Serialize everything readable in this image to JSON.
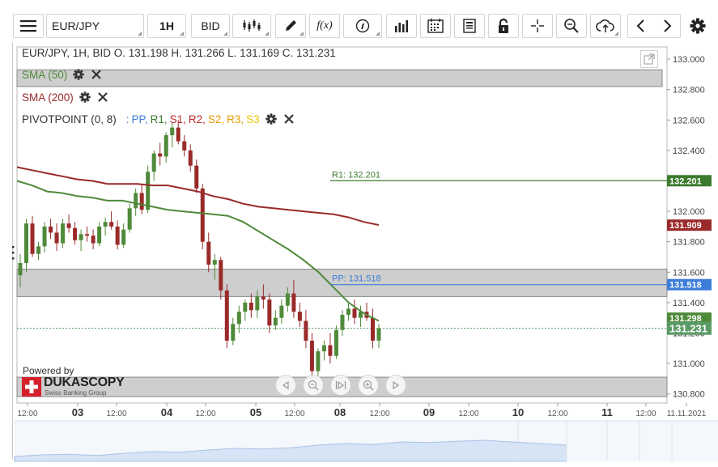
{
  "toolbar": {
    "instrument": "EUR/JPY",
    "timeframe": "1H",
    "offer_side": "BID",
    "function_label": "f(x)",
    "icons": [
      "menu-icon",
      "candle-type-icon",
      "pencil-icon",
      "function-icon",
      "info-icon",
      "bar-chart-icon",
      "calendar-icon",
      "report-icon",
      "lock-icon",
      "crosshair-icon",
      "zoom-icon",
      "cloud-upload-icon",
      "chevron-left-icon",
      "chevron-right-icon",
      "gear-icon"
    ]
  },
  "legend": {
    "ohlc": "EUR/JPY, 1H, BID    O. 131.198 H. 131.266 L. 131.169 C. 131.231",
    "sma50": "SMA (50)",
    "sma200": "SMA (200)",
    "pivot": "PIVOTPOINT (0, 8)",
    "pivot_sep": ":",
    "pivot_levels": [
      "PP,",
      "R1,",
      "S1,",
      "R2,",
      "S2,",
      "R3,",
      "S3"
    ],
    "pivot_colors": [
      "#3b7dd8",
      "#3c7a2e",
      "#c02a2a",
      "#c02a2a",
      "#e69a00",
      "#e69a00",
      "#e6c600"
    ]
  },
  "branding": {
    "powered_by": "Powered by",
    "logo_text": "DUKASCOPY",
    "logo_sub": "Swiss Banking Group"
  },
  "colors": {
    "sma50": "#4f8a3a",
    "sma200": "#9a2a2a",
    "candle_up": "#4f8a3a",
    "candle_down": "#9a2a2a",
    "pp_line": "#3b7dd8",
    "r1_line": "#3c7a2e",
    "price_label": "#5a9a66",
    "zone": "#c6c6c6"
  },
  "chart_data": {
    "type": "candlestick",
    "ylim": [
      130.74,
      133.08
    ],
    "y_ticks": [
      "133.000",
      "132.800",
      "132.600",
      "132.400",
      "132.200",
      "132.000",
      "131.800",
      "131.600",
      "131.400",
      "131.200",
      "131.000",
      "130.800"
    ],
    "x_ticks": [
      "12:00",
      "03",
      "12:00",
      "04",
      "12:00",
      "05",
      "12:00",
      "08",
      "12:00",
      "09",
      "12:00",
      "10",
      "12:00",
      "11",
      "12:00",
      "11.11.2021"
    ],
    "price_labels": [
      {
        "label": "132.201",
        "value": 132.201,
        "kind": "r1"
      },
      {
        "label": "131.909",
        "value": 131.909,
        "kind": "sma200"
      },
      {
        "label": "131.518",
        "value": 131.518,
        "kind": "pp"
      },
      {
        "label": "131.298",
        "value": 131.298,
        "kind": "sma50"
      },
      {
        "label": "131.231",
        "value": 131.231,
        "kind": "last"
      }
    ],
    "pivot_lines": [
      {
        "label": "R1: 132.201",
        "value": 132.201
      },
      {
        "label": "PP: 131.518",
        "value": 131.518
      }
    ],
    "zones": [
      {
        "from": 132.82,
        "to": 132.93
      },
      {
        "from": 131.44,
        "to": 131.62
      },
      {
        "from": 130.88,
        "to": 130.91
      }
    ],
    "series": [
      {
        "name": "SMA (50)",
        "values": [
          132.2,
          132.17,
          132.13,
          132.12,
          132.1,
          132.09,
          132.07,
          132.07,
          132.05,
          132.03,
          132.01,
          132,
          131.99,
          131.98,
          131.97,
          131.93,
          131.87,
          131.81,
          131.75,
          131.68,
          131.6,
          131.5,
          131.4,
          131.33,
          131.28
        ]
      },
      {
        "name": "SMA (200)",
        "values": [
          132.29,
          132.27,
          132.25,
          132.23,
          132.21,
          132.2,
          132.18,
          132.18,
          132.18,
          132.17,
          132.17,
          132.15,
          132.13,
          132.1,
          132.08,
          132.05,
          132.03,
          132.02,
          132.01,
          132,
          131.99,
          131.98,
          131.96,
          131.93,
          131.91
        ]
      }
    ],
    "candles_ohlc": [
      [
        131.58,
        131.72,
        131.5,
        131.66
      ],
      [
        131.66,
        131.95,
        131.6,
        131.92
      ],
      [
        131.92,
        131.97,
        131.7,
        131.72
      ],
      [
        131.72,
        131.8,
        131.68,
        131.77
      ],
      [
        131.77,
        131.93,
        131.73,
        131.9
      ],
      [
        131.9,
        131.95,
        131.82,
        131.86
      ],
      [
        131.86,
        131.92,
        131.74,
        131.79
      ],
      [
        131.79,
        131.95,
        131.76,
        131.92
      ],
      [
        131.92,
        131.98,
        131.86,
        131.89
      ],
      [
        131.89,
        131.93,
        131.78,
        131.81
      ],
      [
        131.81,
        131.88,
        131.74,
        131.85
      ],
      [
        131.85,
        131.9,
        131.8,
        131.84
      ],
      [
        131.84,
        131.88,
        131.75,
        131.79
      ],
      [
        131.79,
        131.93,
        131.77,
        131.9
      ],
      [
        131.9,
        131.96,
        131.84,
        131.93
      ],
      [
        131.93,
        132.0,
        131.88,
        131.9
      ],
      [
        131.9,
        131.94,
        131.75,
        131.78
      ],
      [
        131.78,
        131.92,
        131.76,
        131.88
      ],
      [
        131.88,
        132.05,
        131.86,
        132.02
      ],
      [
        132.02,
        132.15,
        131.97,
        132.12
      ],
      [
        132.12,
        132.18,
        131.98,
        132.01
      ],
      [
        132.01,
        132.3,
        131.99,
        132.26
      ],
      [
        132.26,
        132.4,
        132.2,
        132.38
      ],
      [
        132.38,
        132.45,
        132.3,
        132.36
      ],
      [
        132.36,
        132.52,
        132.32,
        132.5
      ],
      [
        132.5,
        132.58,
        132.42,
        132.55
      ],
      [
        132.55,
        132.6,
        132.44,
        132.46
      ],
      [
        132.46,
        132.5,
        132.36,
        132.4
      ],
      [
        132.4,
        132.44,
        132.26,
        132.3
      ],
      [
        132.3,
        132.34,
        132.12,
        132.15
      ],
      [
        132.15,
        132.18,
        131.75,
        131.8
      ],
      [
        131.8,
        131.86,
        131.6,
        131.65
      ],
      [
        131.65,
        131.72,
        131.55,
        131.68
      ],
      [
        131.68,
        131.7,
        131.42,
        131.48
      ],
      [
        131.48,
        131.52,
        131.1,
        131.15
      ],
      [
        131.15,
        131.3,
        131.12,
        131.26
      ],
      [
        131.26,
        131.38,
        131.2,
        131.34
      ],
      [
        131.34,
        131.42,
        131.28,
        131.4
      ],
      [
        131.4,
        131.46,
        131.3,
        131.35
      ],
      [
        131.35,
        131.48,
        131.3,
        131.44
      ],
      [
        131.44,
        131.52,
        131.36,
        131.42
      ],
      [
        131.42,
        131.46,
        131.2,
        131.25
      ],
      [
        131.25,
        131.35,
        131.22,
        131.3
      ],
      [
        131.3,
        131.42,
        131.26,
        131.38
      ],
      [
        131.38,
        131.5,
        131.34,
        131.46
      ],
      [
        131.46,
        131.55,
        131.3,
        131.34
      ],
      [
        131.34,
        131.4,
        131.24,
        131.28
      ],
      [
        131.28,
        131.35,
        131.1,
        131.15
      ],
      [
        131.15,
        131.2,
        130.9,
        130.95
      ],
      [
        130.95,
        131.1,
        130.92,
        131.08
      ],
      [
        131.08,
        131.15,
        131.02,
        131.12
      ],
      [
        131.12,
        131.2,
        131.0,
        131.05
      ],
      [
        131.05,
        131.25,
        131.03,
        131.22
      ],
      [
        131.22,
        131.35,
        131.18,
        131.32
      ],
      [
        131.32,
        131.4,
        131.28,
        131.36
      ],
      [
        131.36,
        131.42,
        131.26,
        131.3
      ],
      [
        131.3,
        131.38,
        131.24,
        131.34
      ],
      [
        131.34,
        131.4,
        131.28,
        131.3
      ],
      [
        131.3,
        131.36,
        131.1,
        131.15
      ],
      [
        131.15,
        131.26,
        131.1,
        131.23
      ]
    ]
  }
}
